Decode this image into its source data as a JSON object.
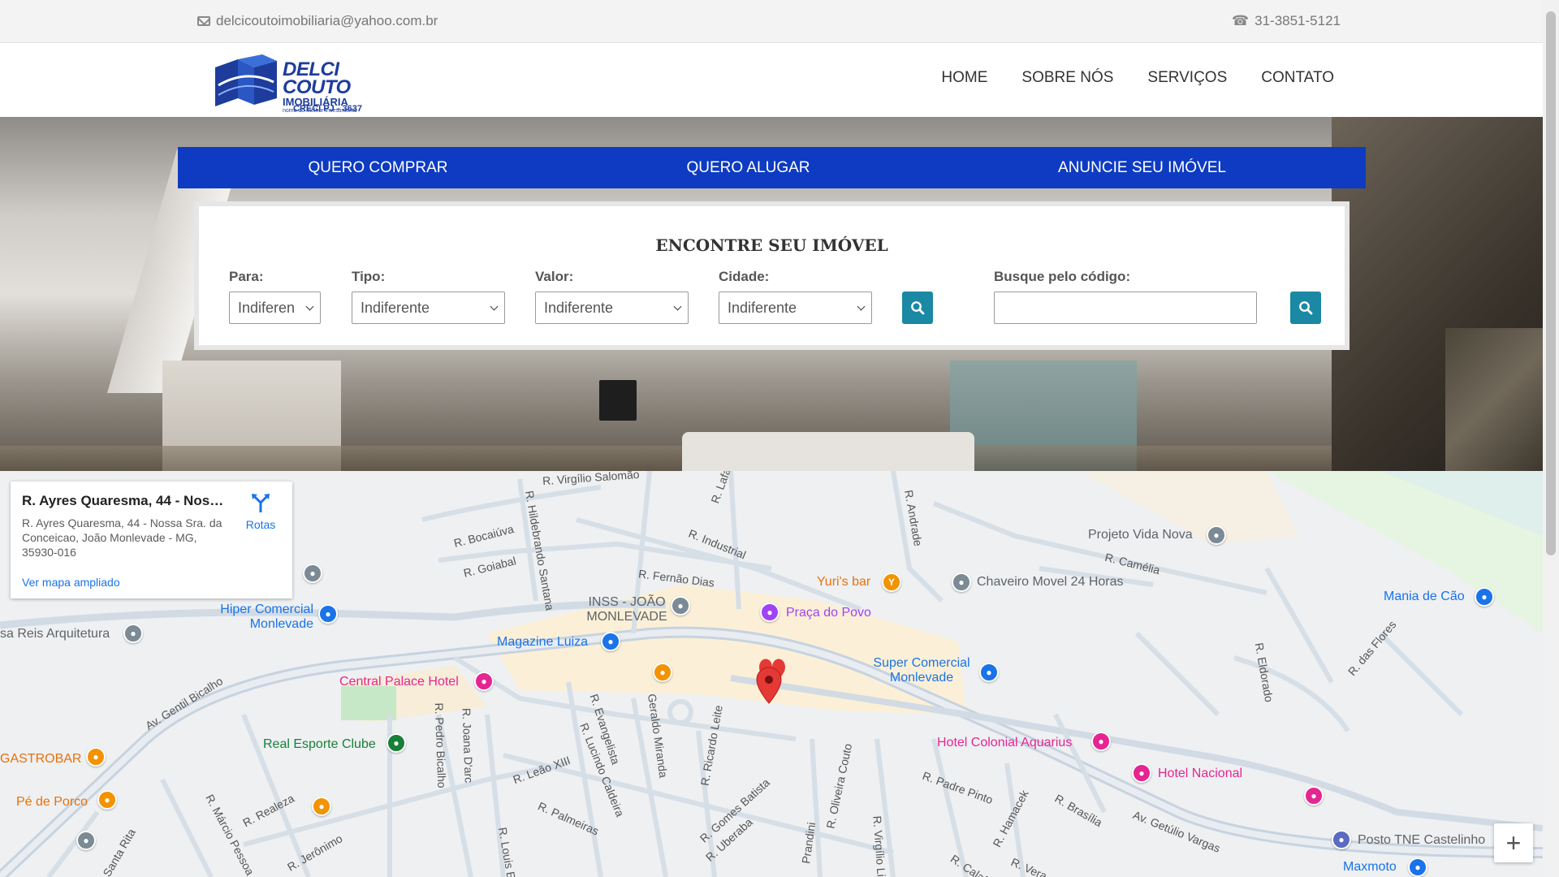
{
  "topbar": {
    "email": "delcicoutoimobiliaria@yahoo.com.br",
    "phone": "31-3851-5121"
  },
  "logo": {
    "title": "DELCI COUTO",
    "subtitle": "IMOBILIÁRIA",
    "tagline": "nome do melhor investimento",
    "creci": "CRECI PJ - 3637"
  },
  "nav": {
    "home": "HOME",
    "about": "SOBRE NÓS",
    "services": "SERVIÇOS",
    "contact": "CONTATO"
  },
  "tabs": {
    "buy": "QUERO COMPRAR",
    "rent": "QUERO ALUGAR",
    "advertise": "ANUNCIE SEU IMÓVEL"
  },
  "search": {
    "title": "ENCONTRE SEU IMÓVEL",
    "para_label": "Para:",
    "para_value": "Indiferen",
    "tipo_label": "Tipo:",
    "tipo_value": "Indiferente",
    "valor_label": "Valor:",
    "valor_value": "Indiferente",
    "cidade_label": "Cidade:",
    "cidade_value": "Indiferente",
    "code_label": "Busque pelo código:",
    "code_value": ""
  },
  "map": {
    "card_title": "R. Ayres Quaresma, 44 - Noss...",
    "card_address": "R. Ayres Quaresma, 44 - Nossa Sra. da Conceicao, João Monlevade - MG, 35930-016",
    "directions_label": "Rotas",
    "enlarge_link": "Ver mapa ampliado",
    "zoom_in": "+",
    "places": {
      "projeto": "Projeto Vida Nova",
      "yuris": "Yuri's bar",
      "chaveiro": "Chaveiro Movel 24 Horas",
      "mania": "Mania de Cão",
      "hiper1": "Hiper Comercial",
      "hiper2": "Monlevade",
      "inss1": "INSS - JOÃO",
      "inss2": "MONLEVADE",
      "praca": "Praça do Povo",
      "reis": "sa Reis Arquitetura",
      "magazine": "Magazine Luiza",
      "super1": "Super Comercial",
      "super2": "Monlevade",
      "central": "Central Palace Hotel",
      "real": "Real Esporte Clube",
      "colonial": "Hotel Colonial Aquarius",
      "gastrobar": "GASTROBAR",
      "nacional": "Hotel Nacional",
      "pe": "Pé de Porco",
      "posto": "Posto TNE Castelinho",
      "maxmoto": "Maxmoto"
    },
    "streets": {
      "virgilio": "R. Virgílio Salomão",
      "bocaiuva": "R. Bocaiúva",
      "goiabal": "R. Goiabal",
      "hildebrando": "R. Hildebrando Santana",
      "industrial": "R. Industrial",
      "fernao": "R. Fernão Dias",
      "andrade": "R. Andrade",
      "camelia": "R. Camélia",
      "lafa": "R. Lafa",
      "gentil": "Av. Gentil Bicalho",
      "evangelista": "R. Evangelista",
      "geraldo": "Geraldo Miranda",
      "ricardo": "R. Ricardo Leite",
      "leao": "R. Leão XIII",
      "lucindo": "R. Lucindo Caldeira",
      "pedro": "R. Pedro Bicalho",
      "joana": "R. Joana D'arc",
      "palmeiras": "R. Palmeiras",
      "gomes": "R. Gomes Batista",
      "uberaba": "R. Uberaba",
      "oliveira": "R. Oliveira Couto",
      "padre": "R. Padre Pinto",
      "hamacek": "R. Hamacek",
      "brasilia": "R. Brasília",
      "getulio": "Av. Getúlio Vargas",
      "eldorado": "R. Eldorado",
      "flores": "R. das Flores",
      "realeza": "R. Realeza",
      "marcio": "R. Márcio Pessoa",
      "rita": "Santa Rita",
      "jeronimo": "R. Jerônimo",
      "luis": "R. Louis Ens",
      "virgilio2": "R. Virgílio Lim",
      "prandini": "Prandini",
      "calaf": "R. Calaf",
      "vera": "R. Vera"
    }
  },
  "colors": {
    "brand_blue": "#0e3bc1",
    "search_button": "#1b88a4",
    "logo_blue": "#1e3c9c"
  }
}
